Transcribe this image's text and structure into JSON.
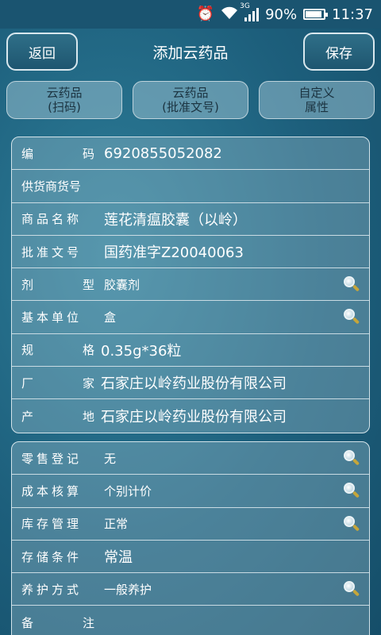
{
  "status_bar": {
    "network": "3G",
    "battery": "90%",
    "battery_level": 0.9,
    "time": "11:37",
    "icons": [
      "alarm-icon",
      "wifi-icon",
      "signal-icon",
      "battery-icon"
    ]
  },
  "header": {
    "back_label": "返回",
    "title": "添加云药品",
    "save_label": "保存"
  },
  "tabs": [
    {
      "label": "云药品\n(扫码)"
    },
    {
      "label": "云药品\n(批准文号)"
    },
    {
      "label": "自定义\n属性"
    }
  ],
  "basic": {
    "code_label": [
      "编",
      "码"
    ],
    "code_value": "6920855052082",
    "supplier_label": "供货商货号",
    "supplier_value": "",
    "name_label": "商品名称",
    "name_value": "莲花清瘟胶囊（以岭）",
    "approval_label": "批准文号",
    "approval_value": "国药准字Z20040063",
    "form_label": [
      "剂",
      "型"
    ],
    "form_value": "胶囊剂",
    "unit_label": "基本单位",
    "unit_value": "盒",
    "spec_label": [
      "规",
      "格"
    ],
    "spec_value": "0.35g*36粒",
    "maker_label": [
      "厂",
      "家"
    ],
    "maker_value": "石家庄以岭药业股份有限公司",
    "origin_label": [
      "产",
      "地"
    ],
    "origin_value": "石家庄以岭药业股份有限公司"
  },
  "extra": {
    "retail_label": "零售登记",
    "retail_value": "无",
    "cost_label": "成本核算",
    "cost_value": "个别计价",
    "stock_label": "库存管理",
    "stock_value": "正常",
    "storage_label": "存储条件",
    "storage_value": "常温",
    "care_label": "养护方式",
    "care_value": "一般养护",
    "note_label": [
      "备",
      "注"
    ],
    "note_value": ""
  }
}
